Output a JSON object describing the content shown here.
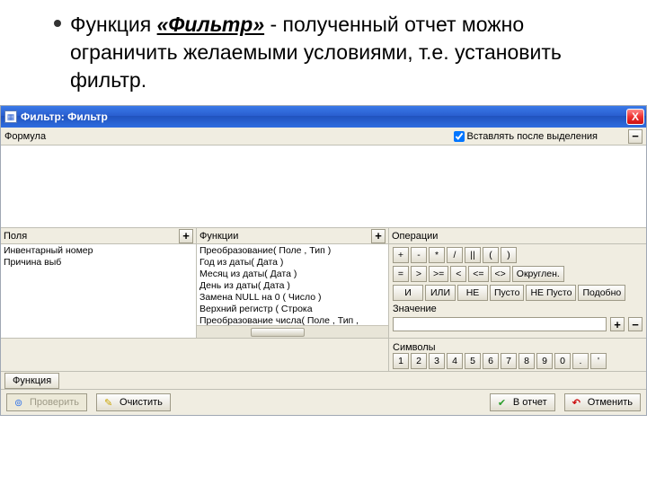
{
  "slide": {
    "bullet_pre": "Функция ",
    "bullet_fn": "«Фильтр»",
    "bullet_post": " - полученный отчет можно ограничить желаемыми условиями, т.е. установить фильтр."
  },
  "titlebar": {
    "icon_glyph": "▦",
    "title": "Фильтр: Фильтр",
    "close_glyph": "X"
  },
  "row_formula": {
    "label": "Формула",
    "checkbox_label": "Вставлять после выделения",
    "checked": true,
    "minus_glyph": "−"
  },
  "columns": {
    "fields": {
      "header": "Поля",
      "plus_glyph": "+",
      "items": [
        "Инвентарный номер",
        "Причина выб"
      ]
    },
    "functions": {
      "header": "Функции",
      "plus_glyph": "+",
      "items": [
        "Преобразование( Поле , Тип )",
        "Год из даты( Дата )",
        "Месяц из даты( Дата )",
        "День из даты( Дата )",
        "Замена NULL на 0 ( Число )",
        "Верхний регистр ( Строка",
        "Преобразование числа( Поле , Тип ,"
      ]
    },
    "operations": {
      "header": "Операции",
      "row1": [
        "+",
        "-",
        "*",
        "/",
        "||",
        "(",
        ")"
      ],
      "row2": [
        "=",
        ">",
        ">=",
        "<",
        "<=",
        "<>",
        "Округлен."
      ],
      "row3": [
        "И",
        "ИЛИ",
        "НЕ",
        "Пусто",
        "НЕ Пусто",
        "Подобно"
      ],
      "value_label": "Значение",
      "plus_glyph": "+",
      "minus_glyph": "−",
      "symbols_label": "Символы",
      "symbols": [
        "1",
        "2",
        "3",
        "4",
        "5",
        "6",
        "7",
        "8",
        "9",
        "0",
        ".",
        "'"
      ]
    }
  },
  "func_bar": {
    "label": "Функция"
  },
  "bottom": {
    "check": "Проверить",
    "clear": "Очистить",
    "save": "В отчет",
    "cancel": "Отменить"
  }
}
